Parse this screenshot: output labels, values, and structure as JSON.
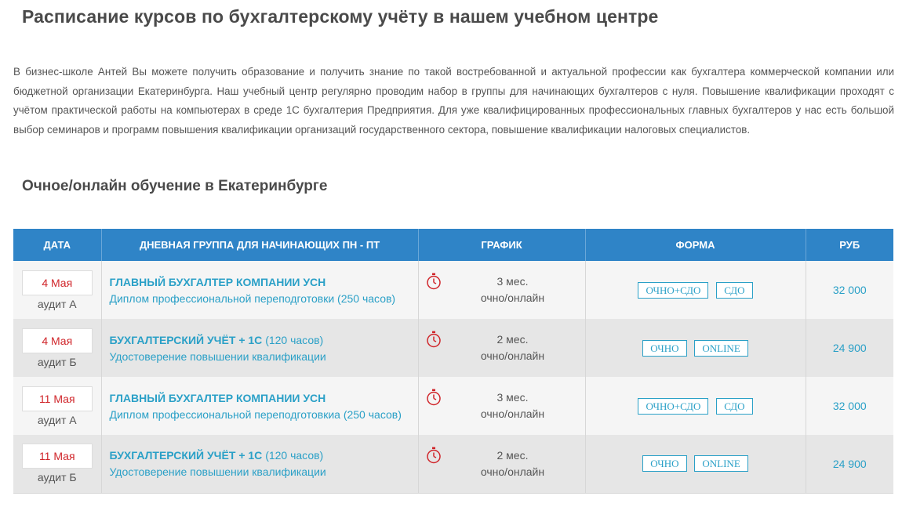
{
  "page": {
    "title": "Расписание курсов по бухгалтерскому учёту в нашем учебном центре",
    "intro": "В бизнес-школе Антей Вы можете получить образование и получить знание по такой востребованной и актуальной профессии как бухгалтера коммерческой компании или бюджетной организации Екатеринбурга. Наш учебный центр регулярно проводим набор в группы для начинающих бухгалтеров с нуля. Повышение квалификации проходят с учётом практической работы на компьютерах в среде 1С бухгалтерия Предприятия. Для уже квалифицированных профессиональных главных бухгалтеров у нас есть большой выбор семинаров и программ повышения квалификации организаций государственного сектора, повышение квалификации налоговых специалистов.",
    "section_title": "Очное/онлайн обучение в Екатеринбурге"
  },
  "colors": {
    "header_bg": "#2f84c7",
    "accent": "#2aa0c7",
    "date": "#d0252a",
    "row_odd": "#f5f5f5",
    "row_even": "#e6e6e6"
  },
  "table": {
    "headers": {
      "date": "Дата",
      "group": "Дневная группа для начинающих пн - пт",
      "schedule": "График",
      "form": "Форма",
      "price": "Руб"
    },
    "rows": [
      {
        "date": "4 Мая",
        "room": "аудит А",
        "course": "ГЛАВНЫЙ БУХГАЛТЕР КОМПАНИИ УСН",
        "hours": "",
        "document": "Диплом профессиональной переподготовки (250 часов)",
        "duration": "3 мес.",
        "mode": "очно/онлайн",
        "form1": "ОЧНО+СДО",
        "form2": "СДО",
        "price": "32 000"
      },
      {
        "date": "4 Мая",
        "room": "аудит Б",
        "course": "БУХГАЛТЕРСКИЙ УЧЁТ + 1С",
        "hours": "(120 часов)",
        "document": "Удостоверение повышении квалификации",
        "duration": "2 мес.",
        "mode": "очно/онлайн",
        "form1": "ОЧНО",
        "form2": "ONLINE",
        "price": "24 900"
      },
      {
        "date": "11 Мая",
        "room": "аудит А",
        "course": "ГЛАВНЫЙ БУХГАЛТЕР КОМПАНИИ УСН",
        "hours": "",
        "document": "Диплом профессиональной переподготовкиа (250 часов)",
        "duration": "3 мес.",
        "mode": "очно/онлайн",
        "form1": "ОЧНО+СДО",
        "form2": "СДО",
        "price": "32 000"
      },
      {
        "date": "11 Мая",
        "room": "аудит Б",
        "course": "БУХГАЛТЕРСКИЙ УЧЁТ + 1С",
        "hours": "(120 часов)",
        "document": "Удостоверение повышении квалификации",
        "duration": "2 мес.",
        "mode": "очно/онлайн",
        "form1": "ОЧНО",
        "form2": "ONLINE",
        "price": "24 900"
      }
    ]
  }
}
